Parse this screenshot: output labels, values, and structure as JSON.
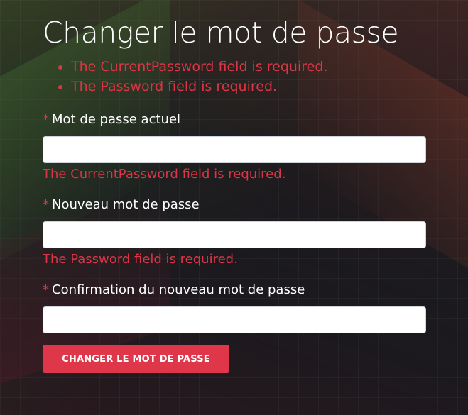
{
  "page": {
    "title": "Changer le mot de passe"
  },
  "validation_summary": [
    "The CurrentPassword field is required.",
    "The Password field is required."
  ],
  "form": {
    "current_password": {
      "required_marker": "*",
      "label": "Mot de passe actuel",
      "value": "",
      "error": "The CurrentPassword field is required."
    },
    "new_password": {
      "required_marker": "*",
      "label": "Nouveau mot de passe",
      "value": "",
      "error": "The Password field is required."
    },
    "confirm_password": {
      "required_marker": "*",
      "label": "Confirmation du nouveau mot de passe",
      "value": ""
    },
    "submit_label": "CHANGER LE MOT DE PASSE"
  },
  "colors": {
    "accent": "#e0364a",
    "error": "#dc3545",
    "background": "#17191e",
    "text": "#ffffff"
  }
}
